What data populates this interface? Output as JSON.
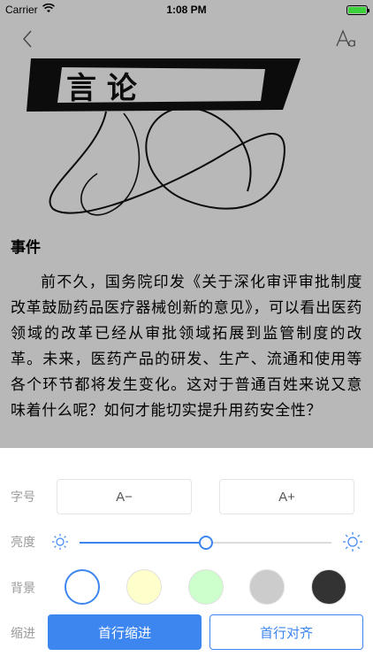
{
  "status_bar": {
    "carrier": "Carrier",
    "time": "1:08 PM",
    "battery_color": "#3bd13b"
  },
  "navbar": {
    "back_icon": "chevron-left-icon",
    "font_icon": "text-size-icon"
  },
  "article": {
    "section_title": "事件",
    "paragraph": "前不久，国务院印发《关于深化审评审批制度改革鼓励药品医疗器械创新的意见》，可以看出医药领域的改革已经从审批领域拓展到监管制度的改革。未来，医药产品的研发、生产、流通和使用等各个环节都将发生变化。这对于普通百姓来说又意味着什么呢？如何才能切实提升用药安全性？",
    "hero_text": "言 论"
  },
  "settings": {
    "font_size": {
      "label": "字号",
      "decrease": "A−",
      "increase": "A+"
    },
    "brightness": {
      "label": "亮度",
      "level_fraction": 0.5,
      "low_icon": "sun-small-icon",
      "high_icon": "sun-large-icon"
    },
    "background": {
      "label": "背景",
      "colors": [
        "#ffffff",
        "#ffffcc",
        "#ccffcc",
        "#cccccc",
        "#333333"
      ],
      "selected_index": 0
    },
    "indent": {
      "label": "缩进",
      "first_line_indent": "首行缩进",
      "first_line_align": "首行对齐"
    },
    "accent_color": "#3d86f0"
  }
}
